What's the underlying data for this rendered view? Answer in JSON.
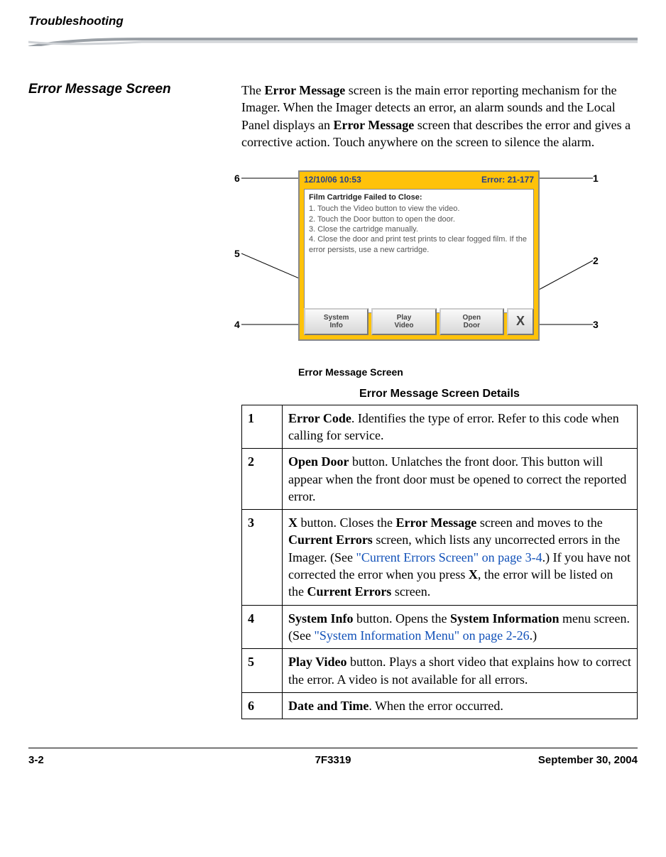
{
  "header": {
    "chapter_title": "Troubleshooting"
  },
  "section": {
    "heading": "Error Message Screen"
  },
  "intro": {
    "t1": "The ",
    "b1": "Error Message",
    "t2": " screen is the main error reporting mechanism for the Imager. When the Imager detects an error, an alarm sounds and the Local Panel displays an ",
    "b2": "Error Message",
    "t3": " screen that describes the error and gives a corrective action. Touch anywhere on the screen to silence the alarm."
  },
  "screenshot": {
    "datetime": "12/10/06 10:53",
    "error_label": "Error:  21-177",
    "msg_title": "Film Cartridge Failed to Close:",
    "msg_l1": "1. Touch the Video button to view the video.",
    "msg_l2": "2. Touch the Door button to open the door.",
    "msg_l3": "3. Close the cartridge manually.",
    "msg_l4": "4. Close the door and print test prints to clear fogged film. If the error persists, use a new cartridge.",
    "btn1_line1": "System",
    "btn1_line2": "Info",
    "btn2_line1": "Play",
    "btn2_line2": "Video",
    "btn3_line1": "Open",
    "btn3_line2": "Door",
    "btnX": "X"
  },
  "figure_caption": "Error Message Screen",
  "table_caption": "Error Message Screen Details",
  "callouts": {
    "n1": "1",
    "n2": "2",
    "n3": "3",
    "n4": "4",
    "n5": "5",
    "n6": "6"
  },
  "rows": {
    "r1": {
      "num": "1",
      "b1": "Error Code",
      "t1": ".  Identifies the type of error. Refer to this code when calling for service."
    },
    "r2": {
      "num": "2",
      "b1": "Open Door",
      "t1": " button.  Unlatches the front door. This button will appear when the front door must be opened to correct the reported error."
    },
    "r3": {
      "num": "3",
      "b1": "X",
      "t1": " button.  Closes the ",
      "b2": "Error Message",
      "t2": " screen and moves to the ",
      "b3": "Current Errors",
      "t3": " screen, which lists any uncorrected errors in the Imager. (See ",
      "link1": "\"Current Errors Screen\" on page 3-4",
      "t4": ".) If you have not corrected the error when you press ",
      "b4": "X",
      "t5": ", the error will be listed on the ",
      "b5": "Current Errors",
      "t6": " screen."
    },
    "r4": {
      "num": "4",
      "b1": "System Info",
      "t1": " button.  Opens the ",
      "b2": "System Information",
      "t2": " menu screen. (See ",
      "link1": "\"System Information Menu\" on page 2-26",
      "t3": ".)"
    },
    "r5": {
      "num": "5",
      "b1": "Play Video",
      "t1": " button.  Plays a short video that explains how to correct the error. A video is not available for all errors."
    },
    "r6": {
      "num": "6",
      "b1": "Date and Time",
      "t1": ".  When the error occurred."
    }
  },
  "footer": {
    "page": "3-2",
    "doc": "7F3319",
    "date": "September 30, 2004"
  }
}
